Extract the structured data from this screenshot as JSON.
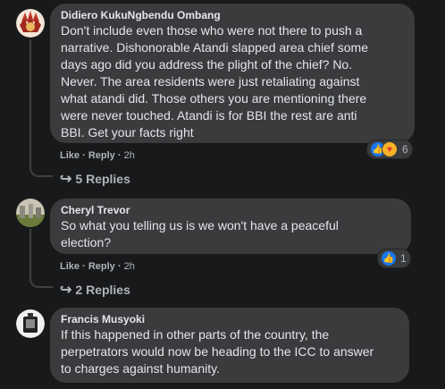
{
  "comments": [
    {
      "author": "Didiero KukuNgbendu Ombang",
      "text": "Don't include even those who were not there to push a\nnarrative. Dishonorable Atandi slapped area chief some\ndays ago did you address the plight of the chief? No.\nNever. The area residents were just retaliating against\nwhat atandi did. Those others you are mentioning there\nwere never touched. Atandi is for BBI the rest are anti\nBBI. Get your facts right",
      "like": "Like",
      "reply": "Reply",
      "time": "2h",
      "reaction_count": "6",
      "replies": "5 Replies"
    },
    {
      "author": "Cheryl Trevor",
      "text": "So what you telling us is we won't have a peaceful\nelection?",
      "like": "Like",
      "reply": "Reply",
      "time": "2h",
      "reaction_count": "1",
      "replies": "2 Replies"
    },
    {
      "author": "Francis Musyoki",
      "text": "If this happened in other parts of the country, the\nperpetrators would now be heading to the ICC to answer\nto charges against humanity."
    }
  ],
  "separator": "·",
  "icons": {
    "like": "like-reaction-icon",
    "care": "care-reaction-icon",
    "reply_arrow": "reply-arrow-icon"
  },
  "colors": {
    "background": "#18191a",
    "bubble": "#3a3b3c",
    "like_blue": "#1877f2"
  }
}
